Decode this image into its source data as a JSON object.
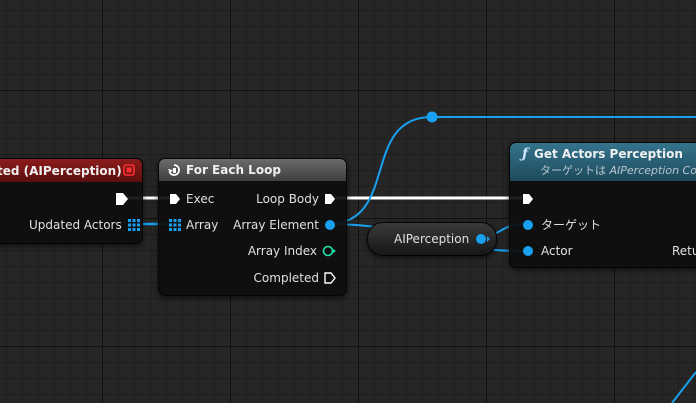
{
  "event_node": {
    "title": "ted (AIPerception)",
    "pin_updated_actors": "Updated Actors"
  },
  "for_each_node": {
    "title": "For Each Loop",
    "pin_exec": "Exec",
    "pin_array": "Array",
    "pin_loop_body": "Loop Body",
    "pin_array_element": "Array Element",
    "pin_array_index": "Array Index",
    "pin_completed": "Completed"
  },
  "variable_node": {
    "label": "AIPerception"
  },
  "get_actors_node": {
    "title": "Get Actors Perception",
    "subtitle_prefix": "ターゲットは",
    "subtitle_target": "AIPerception Co",
    "pin_target": "ターゲット",
    "pin_actor": "Actor",
    "pin_return": "Retu"
  },
  "colors": {
    "exec": "#ffffff",
    "object_pin": "#1aa0f0",
    "int_pin": "#1ee3b0",
    "event_header": "#7a1414",
    "function_header": "#2d6277",
    "macro_header": "#5a5a5a"
  }
}
